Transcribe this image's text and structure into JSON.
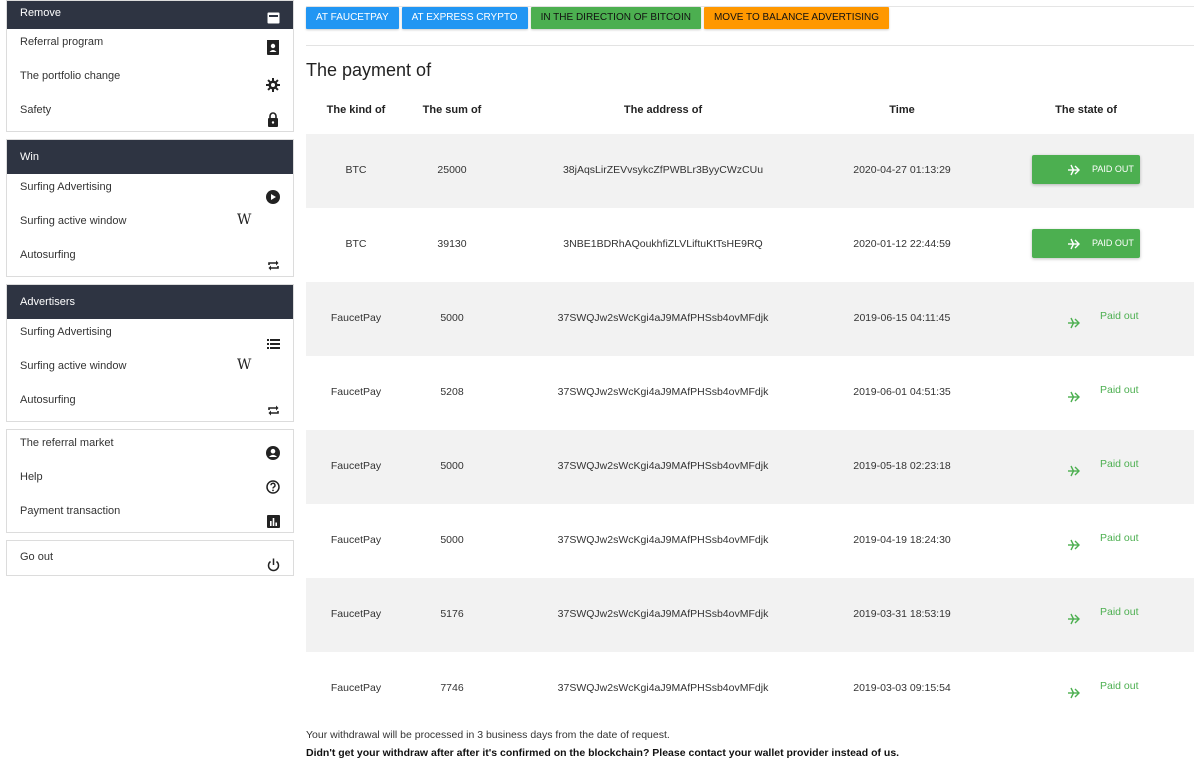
{
  "sidebar": {
    "group1": [
      {
        "label": "Remove",
        "icon": "card-icon"
      },
      {
        "label": "Referral program",
        "icon": "contact-book-icon"
      },
      {
        "label": "The portfolio change",
        "icon": "gear-icon"
      },
      {
        "label": "Safety",
        "icon": "lock-icon"
      }
    ],
    "win": {
      "title": "Win",
      "items": [
        {
          "label": "Surfing Advertising",
          "icon": "play-icon"
        },
        {
          "label": "Surfing active window",
          "icon": "wikipedia-icon",
          "glyph": "W"
        },
        {
          "label": "Autosurfing",
          "icon": "repeat-icon"
        }
      ]
    },
    "advertisers": {
      "title": "Advertisers",
      "items": [
        {
          "label": "Surfing Advertising",
          "icon": "list-icon"
        },
        {
          "label": "Surfing active window",
          "icon": "wikipedia-icon",
          "glyph": "W"
        },
        {
          "label": "Autosurfing",
          "icon": "repeat-icon"
        }
      ]
    },
    "group4": [
      {
        "label": "The referral market",
        "icon": "account-icon"
      },
      {
        "label": "Help",
        "icon": "help-icon"
      },
      {
        "label": "Payment transaction",
        "icon": "bar-chart-icon"
      }
    ],
    "logout": {
      "label": "Go out",
      "icon": "power-icon"
    }
  },
  "tabs": [
    {
      "label": "AT FAUCETPAY",
      "color": "#2196f3"
    },
    {
      "label": "AT EXPRESS CRYPTO",
      "color": "#2196f3"
    },
    {
      "label": "IN THE DIRECTION OF BITCOIN",
      "color": "#4caf50"
    },
    {
      "label": "MOVE TO BALANCE ADVERTISING",
      "color": "#ff9800"
    }
  ],
  "payments": {
    "title": "The payment of",
    "columns": [
      "The kind of",
      "The sum of",
      "The address of",
      "Time",
      "The state of"
    ],
    "rows": [
      {
        "kind": "BTC",
        "sum": "25000",
        "address": "38jAqsLirZEVvsykcZfPWBLr3ByyCWzCUu",
        "time": "2020-04-27 01:13:29",
        "state": "PAID OUT",
        "style": "button"
      },
      {
        "kind": "BTC",
        "sum": "39130",
        "address": "3NBE1BDRhAQoukhfiZLVLiftuKtTsHE9RQ",
        "time": "2020-01-12 22:44:59",
        "state": "PAID OUT",
        "style": "button"
      },
      {
        "kind": "FaucetPay",
        "sum": "5000",
        "address": "37SWQJw2sWcKgi4aJ9MAfPHSsb4ovMFdjk",
        "time": "2019-06-15 04:11:45",
        "state": "Paid out",
        "style": "text"
      },
      {
        "kind": "FaucetPay",
        "sum": "5208",
        "address": "37SWQJw2sWcKgi4aJ9MAfPHSsb4ovMFdjk",
        "time": "2019-06-01 04:51:35",
        "state": "Paid out",
        "style": "text"
      },
      {
        "kind": "FaucetPay",
        "sum": "5000",
        "address": "37SWQJw2sWcKgi4aJ9MAfPHSsb4ovMFdjk",
        "time": "2019-05-18 02:23:18",
        "state": "Paid out",
        "style": "text"
      },
      {
        "kind": "FaucetPay",
        "sum": "5000",
        "address": "37SWQJw2sWcKgi4aJ9MAfPHSsb4ovMFdjk",
        "time": "2019-04-19 18:24:30",
        "state": "Paid out",
        "style": "text"
      },
      {
        "kind": "FaucetPay",
        "sum": "5176",
        "address": "37SWQJw2sWcKgi4aJ9MAfPHSsb4ovMFdjk",
        "time": "2019-03-31 18:53:19",
        "state": "Paid out",
        "style": "text"
      },
      {
        "kind": "FaucetPay",
        "sum": "7746",
        "address": "37SWQJw2sWcKgi4aJ9MAfPHSsb4ovMFdjk",
        "time": "2019-03-03 09:15:54",
        "state": "Paid out",
        "style": "text"
      }
    ]
  },
  "notes": {
    "processing": "Your withdrawal will be processed in 3 business days from the date of request.",
    "contact": "Didn't get your withdraw after after it's confirmed on the blockchain? Please contact your wallet provider instead of us."
  },
  "colors": {
    "sidebar_header": "#2e3442",
    "success": "#4caf50",
    "info": "#2196f3",
    "warning": "#ff9800"
  }
}
